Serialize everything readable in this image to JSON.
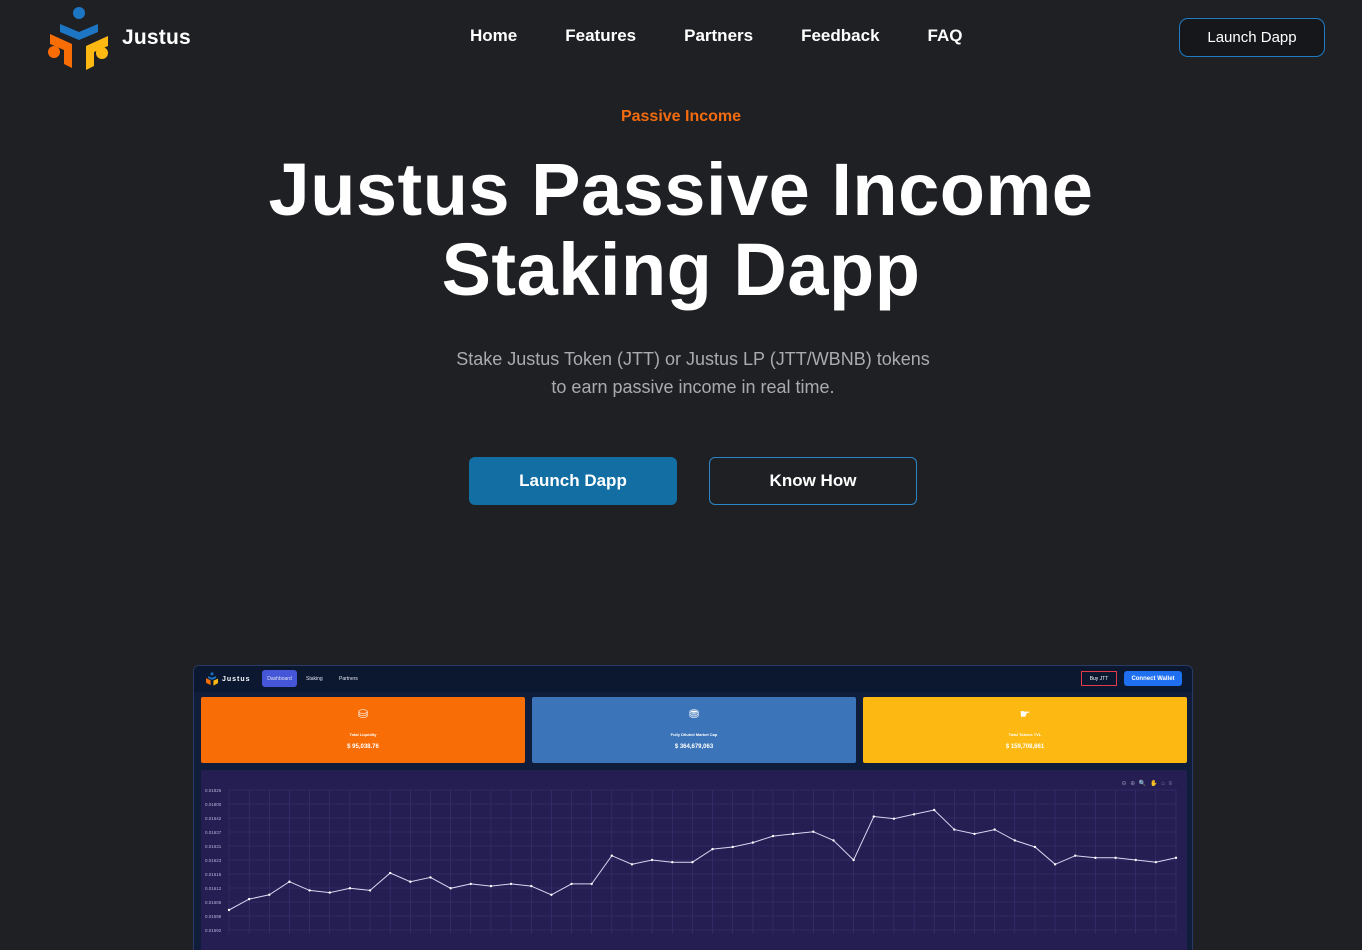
{
  "brand": {
    "name": "Justus"
  },
  "nav": {
    "links": [
      "Home",
      "Features",
      "Partners",
      "Feedback",
      "FAQ"
    ],
    "cta": "Launch Dapp"
  },
  "hero": {
    "eyebrow": "Passive Income",
    "title_line1": "Justus Passive Income",
    "title_line2": "Staking Dapp",
    "sub_line1": "Stake Justus Token (JTT) or Justus LP (JTT/WBNB) tokens",
    "sub_line2": "to earn passive income in real time.",
    "primary_button": "Launch Dapp",
    "secondary_button": "Know How"
  },
  "dashboard_preview": {
    "brand": "Justus",
    "tabs": [
      "Dashboard",
      "Staking",
      "Partners"
    ],
    "buy_button": "Buy JTT",
    "connect_button": "Connect Wallet",
    "stats": [
      {
        "label": "Total Liquidity",
        "value": "$ 95,038.76",
        "color": "#f96d07",
        "icon": "coin-stack-icon"
      },
      {
        "label": "Fully Diluted Market Cap",
        "value": "$ 364,679,063",
        "color": "#3b74b8",
        "icon": "money-bag-icon"
      },
      {
        "label": "Total Tokens TVL",
        "value": "$ 159,708,861",
        "color": "#fdb911",
        "icon": "coin-hand-icon"
      }
    ],
    "chart_tools": "⊖ ⊕ 🔍 ✋ ⌂ ≡",
    "chart_data": {
      "type": "line",
      "y_ticks": [
        "0.01826",
        "0.01800",
        "0.01642",
        "0.01637",
        "0.01631",
        "0.01623",
        "0.01616",
        "0.01612",
        "0.01606",
        "0.01598",
        "0.01592"
      ],
      "values": [
        0.0159,
        0.01595,
        0.01597,
        0.01603,
        0.01599,
        0.01598,
        0.016,
        0.01599,
        0.01607,
        0.01603,
        0.01605,
        0.016,
        0.01602,
        0.01601,
        0.01602,
        0.01601,
        0.01597,
        0.01602,
        0.01602,
        0.01615,
        0.01611,
        0.01613,
        0.01612,
        0.01612,
        0.01618,
        0.01619,
        0.01621,
        0.01624,
        0.01625,
        0.01626,
        0.01622,
        0.01613,
        0.01633,
        0.01632,
        0.01634,
        0.01636,
        0.01627,
        0.01625,
        0.01627,
        0.01622,
        0.01619,
        0.01611,
        0.01615,
        0.01614,
        0.01614,
        0.01613,
        0.01612,
        0.01614
      ]
    }
  },
  "colors": {
    "background": "#1f2023",
    "accent": "#f26b0f",
    "primary": "#126ea3",
    "outline": "#2b86c8"
  }
}
